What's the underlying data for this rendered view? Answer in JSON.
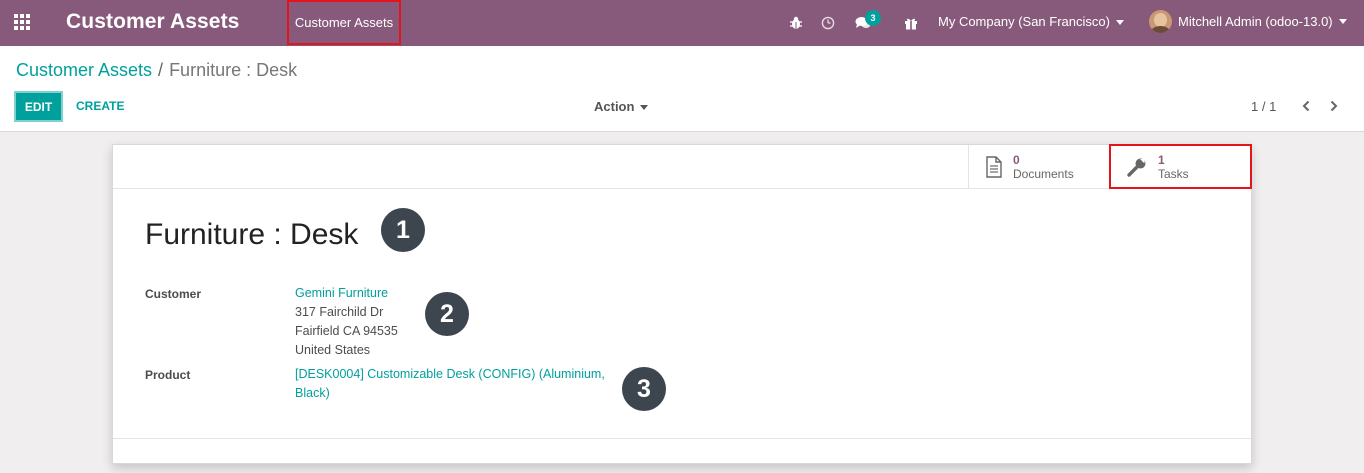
{
  "navbar": {
    "app_title": "Customer Assets",
    "menu_item": "Customer Assets",
    "messages_badge": "3",
    "company": "My Company (San Francisco)",
    "user": "Mitchell Admin (odoo-13.0)"
  },
  "control_panel": {
    "breadcrumb_parent": "Customer Assets",
    "breadcrumb_separator": "/",
    "breadcrumb_current": "Furniture : Desk",
    "edit_label": "EDIT",
    "create_label": "CREATE",
    "action_label": "Action",
    "pager": "1 / 1"
  },
  "stat_buttons": {
    "documents": {
      "value": "0",
      "label": "Documents"
    },
    "tasks": {
      "value": "1",
      "label": "Tasks"
    }
  },
  "form": {
    "title": "Furniture : Desk",
    "customer_label": "Customer",
    "customer_name": "Gemini Furniture",
    "address_line1": "317 Fairchild Dr",
    "address_line2": "Fairfield CA 94535",
    "address_line3": "United States",
    "product_label": "Product",
    "product_line1": "[DESK0004] Customizable Desk (CONFIG) (Aluminium,",
    "product_line2": "Black)"
  },
  "callouts": [
    "1",
    "2",
    "3"
  ],
  "colors": {
    "navbar": "#875a7b",
    "accent": "#00a09d",
    "highlight": "#e5141a",
    "callout": "#3d464f"
  }
}
